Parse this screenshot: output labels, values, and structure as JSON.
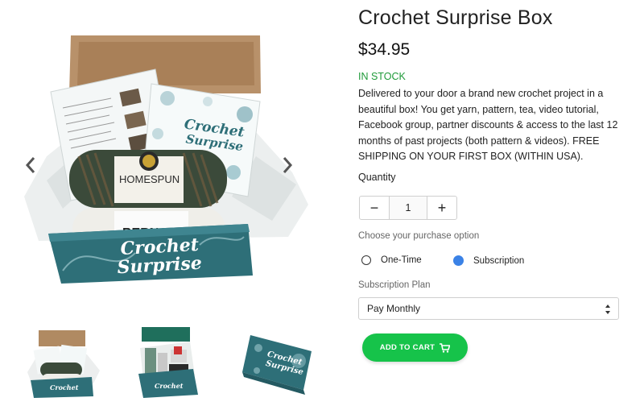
{
  "product": {
    "title": "Crochet Surprise Box",
    "price": "$34.95",
    "stock_status": "IN STOCK",
    "description": "Delivered to your door a brand new crochet project in a beautiful box! You get yarn, pattern, tea, video tutorial, Facebook group, partner discounts & access to the last 12 months of past projects (both pattern & videos). FREE SHIPPING ON YOUR FIRST BOX (WITHIN USA)."
  },
  "gallery": {
    "main_image_texts": {
      "brand_line_1": "Crochet",
      "brand_line_2": "Surprise",
      "yarn_label_1": "HOMESPUN",
      "yarn_label_2": "BERNAT",
      "card_text_1": "Crochet",
      "card_text_2": "Surprise"
    },
    "thumbnails": [
      "thumbnail-1",
      "thumbnail-2",
      "thumbnail-3"
    ],
    "thumb_brand": "Crochet",
    "thumb_brand_2": "Surprise"
  },
  "quantity": {
    "label": "Quantity",
    "value": "1",
    "minus": "−",
    "plus": "+"
  },
  "purchase_option": {
    "label": "Choose your purchase option",
    "options": [
      {
        "label": "One-Time",
        "selected": false
      },
      {
        "label": "Subscription",
        "selected": true
      }
    ]
  },
  "subscription_plan": {
    "label": "Subscription Plan",
    "selected": "Pay Monthly"
  },
  "cart": {
    "label": "ADD TO CART"
  },
  "colors": {
    "accent_green": "#16c34a",
    "stock_green": "#1f9a39",
    "radio_blue": "#3b82e6",
    "box_teal": "#2e6f78"
  },
  "icons": {
    "prev": "chevron-left-icon",
    "next": "chevron-right-icon",
    "cart": "cart-icon",
    "select": "sort-arrows-icon"
  }
}
